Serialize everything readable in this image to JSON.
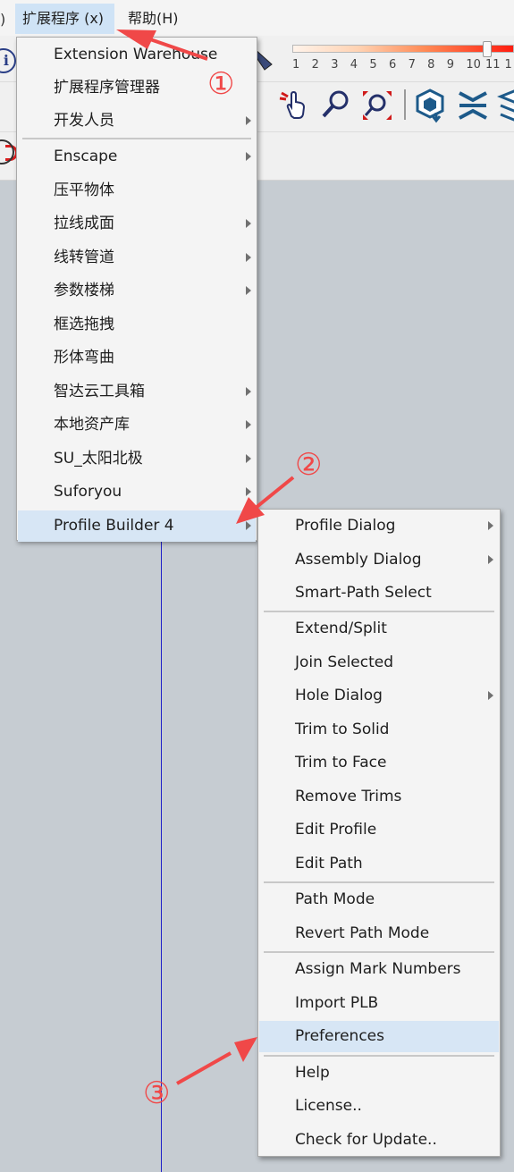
{
  "menubar": {
    "edge_glyph": ")",
    "extensions": "扩展程序 (x)",
    "help": "帮助(H)"
  },
  "toolbar": {
    "info_icon": "i",
    "scale_numbers": [
      "1",
      "2",
      "3",
      "4",
      "5",
      "6",
      "7",
      "8",
      "9",
      "10",
      "11",
      "1"
    ],
    "tool_icons": [
      "hand-pointer-icon",
      "magnifier-icon",
      "zoom-extents-icon",
      "package-download-icon",
      "unfold-arrows-icon",
      "layers-icon"
    ]
  },
  "main_menu": {
    "items": [
      {
        "label": "Extension Warehouse",
        "submenu": false
      },
      {
        "label": "扩展程序管理器",
        "submenu": false
      },
      {
        "label": "开发人员",
        "submenu": true
      },
      {
        "label": "Enscape",
        "submenu": true
      },
      {
        "label": "压平物体",
        "submenu": false
      },
      {
        "label": "拉线成面",
        "submenu": true
      },
      {
        "label": "线转管道",
        "submenu": true
      },
      {
        "label": "参数楼梯",
        "submenu": true
      },
      {
        "label": "框选拖拽",
        "submenu": false
      },
      {
        "label": "形体弯曲",
        "submenu": false
      },
      {
        "label": "智达云工具箱",
        "submenu": true
      },
      {
        "label": "本地资产库",
        "submenu": true
      },
      {
        "label": "SU_太阳北极",
        "submenu": true
      },
      {
        "label": "Suforyou",
        "submenu": true
      },
      {
        "label": "Profile Builder 4",
        "submenu": true,
        "highlighted": true
      }
    ]
  },
  "sub_menu": {
    "items": [
      {
        "label": "Profile Dialog",
        "submenu": true
      },
      {
        "label": "Assembly Dialog",
        "submenu": true
      },
      {
        "label": "Smart-Path Select",
        "submenu": false
      },
      {
        "label": "Extend/Split",
        "submenu": false
      },
      {
        "label": "Join Selected",
        "submenu": false
      },
      {
        "label": "Hole Dialog",
        "submenu": true
      },
      {
        "label": "Trim to Solid",
        "submenu": false
      },
      {
        "label": "Trim to Face",
        "submenu": false
      },
      {
        "label": "Remove Trims",
        "submenu": false
      },
      {
        "label": "Edit Profile",
        "submenu": false
      },
      {
        "label": "Edit Path",
        "submenu": false
      },
      {
        "label": "Path Mode",
        "submenu": false
      },
      {
        "label": "Revert Path Mode",
        "submenu": false
      },
      {
        "label": "Assign Mark Numbers",
        "submenu": false
      },
      {
        "label": "Import PLB",
        "submenu": false
      },
      {
        "label": "Preferences",
        "submenu": false,
        "highlighted": true
      },
      {
        "label": "Help",
        "submenu": false
      },
      {
        "label": "License..",
        "submenu": false
      },
      {
        "label": "Check for Update..",
        "submenu": false
      }
    ]
  },
  "annotations": {
    "step1": "①",
    "step2": "②",
    "step3": "③",
    "color": "#f04848"
  },
  "colors": {
    "menu_highlight": "#d7e6f5",
    "menubar_active": "#cfe3f6",
    "canvas": "#c6ccd2",
    "axis_blue": "#2020c8"
  }
}
